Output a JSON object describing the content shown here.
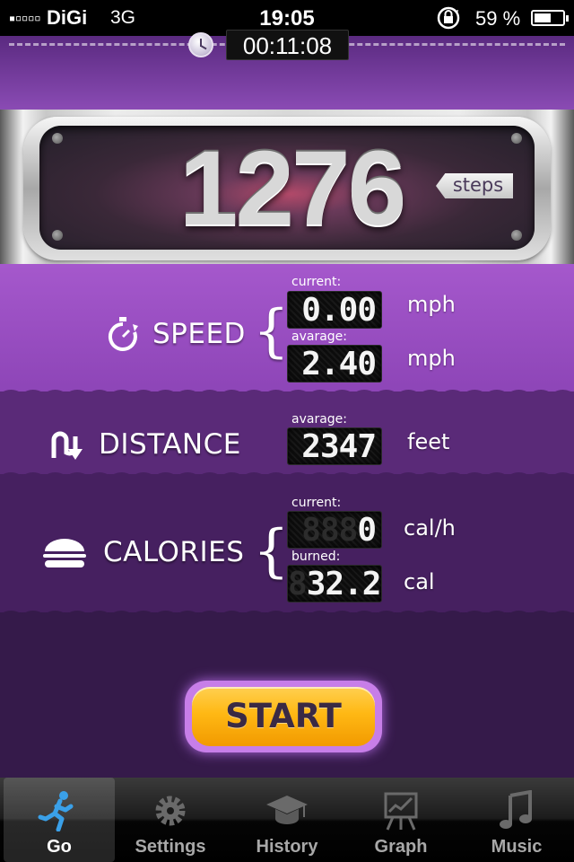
{
  "status_bar": {
    "signal": "▪▫▫▫▫",
    "carrier": "DiGi",
    "network": "3G",
    "time": "19:05",
    "battery": "59 %",
    "battery_level": 0.59
  },
  "timer": {
    "elapsed": "00:11:08"
  },
  "counter": {
    "steps_value": "1276",
    "steps_unit": "steps"
  },
  "speed": {
    "label": "SPEED",
    "current_label": "current:",
    "current_value": "0.00",
    "current_unit": "mph",
    "average_label": "avarage:",
    "average_value": "2.40",
    "average_unit": "mph"
  },
  "distance": {
    "label": "DISTANCE",
    "average_label": "avarage:",
    "value": "2347",
    "unit": "feet"
  },
  "calories": {
    "label": "CALORIES",
    "current_label": "current:",
    "current_ghost": "888",
    "current_value": "0",
    "current_unit": "cal/h",
    "burned_label": "burned:",
    "burned_ghost": "8",
    "burned_value": "32.2",
    "burned_unit": "cal"
  },
  "brace": "{",
  "start_button": {
    "label": "START"
  },
  "tabs": [
    {
      "label": "Go",
      "icon": "runner-icon",
      "active": true
    },
    {
      "label": "Settings",
      "icon": "gear-icon",
      "active": false
    },
    {
      "label": "History",
      "icon": "graduation-cap-icon",
      "active": false
    },
    {
      "label": "Graph",
      "icon": "graph-board-icon",
      "active": false
    },
    {
      "label": "Music",
      "icon": "music-note-icon",
      "active": false
    }
  ],
  "colors": {
    "accent_purple": "#8c44b6",
    "start_orange": "#ffb814",
    "active_tab_blue": "#3aa0e8"
  }
}
